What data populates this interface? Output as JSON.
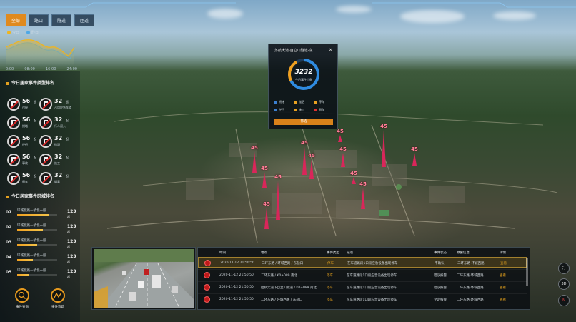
{
  "tabs": [
    {
      "label": "全部",
      "active": true
    },
    {
      "label": "路口",
      "active": false
    },
    {
      "label": "隧道",
      "active": false
    },
    {
      "label": "匝道",
      "active": false
    }
  ],
  "legend": {
    "today": "今日",
    "yesterday": "昨日",
    "today_color": "#f0b51e",
    "yesterday_color": "#4da8e6"
  },
  "trend_axis": [
    "0:00",
    "08:00",
    "16:00",
    "24:00"
  ],
  "event_type_title": "今日居家事件类型排名",
  "event_types": [
    {
      "value": "56",
      "unit": "起",
      "label": "违停"
    },
    {
      "value": "32",
      "unit": "起",
      "label": "占用应急车道"
    },
    {
      "value": "56",
      "unit": "起",
      "label": "拥堵"
    },
    {
      "value": "32",
      "unit": "起",
      "label": "行人闯入"
    },
    {
      "value": "56",
      "unit": "起",
      "label": "逆行"
    },
    {
      "value": "32",
      "unit": "起",
      "label": "抛洒"
    },
    {
      "value": "56",
      "unit": "起",
      "label": "事故"
    },
    {
      "value": "32",
      "unit": "起",
      "label": "施工"
    },
    {
      "value": "56",
      "unit": "起",
      "label": "倒车"
    },
    {
      "value": "32",
      "unit": "起",
      "label": "烟雾"
    }
  ],
  "region_title": "今日居家事件区域排名",
  "regions": [
    {
      "no": "07",
      "name": "环城北路—桥北一段",
      "value": "123",
      "unit": "起",
      "progress": 0.8
    },
    {
      "no": "02",
      "name": "环城北路—桥北一段",
      "value": "123",
      "unit": "起",
      "progress": 0.65
    },
    {
      "no": "03",
      "name": "环城北路—桥北一段",
      "value": "123",
      "unit": "起",
      "progress": 0.5
    },
    {
      "no": "04",
      "name": "环城北路—桥北一段",
      "value": "123",
      "unit": "起",
      "progress": 0.4
    },
    {
      "no": "05",
      "name": "环城北路—桥北一段",
      "value": "123",
      "unit": "起",
      "progress": 0.3
    }
  ],
  "bottom_buttons": {
    "query": "事件查询",
    "trace": "事件追踪"
  },
  "popup": {
    "title": "苏航大道-自立山隧道-东",
    "count": "3232",
    "count_label": "今日事件个数",
    "options": [
      "拥堵",
      "抛洒",
      "停车",
      "逆行",
      "施工",
      "倒车"
    ],
    "confirm": "筛选"
  },
  "markers": [
    {
      "value": "45"
    },
    {
      "value": "45"
    },
    {
      "value": "45"
    },
    {
      "value": "45"
    },
    {
      "value": "45"
    },
    {
      "value": "45"
    },
    {
      "value": "45"
    },
    {
      "value": "45"
    },
    {
      "value": "45"
    },
    {
      "value": "45"
    },
    {
      "value": "45"
    },
    {
      "value": "45"
    }
  ],
  "table": {
    "headers": [
      "时间",
      "地点",
      "事件类型",
      "描述",
      "事件状态",
      "预警信息",
      "详情"
    ],
    "rows": [
      {
        "time": "2020-11-12 21:50:50",
        "place": "二环东路 / 环城西路 / 东盐口",
        "type": "停车",
        "desc": "在车道路段1口段应急设备出现停车",
        "state": "不确认",
        "warn": "二环东路-环城西路",
        "detail": "查看",
        "highlight": true
      },
      {
        "time": "2020-11-12 21:50:50",
        "place": "二环东路 / K0+089 南北",
        "type": "停车",
        "desc": "在车道路段1口段应急设备出现停车",
        "state": "错误报警",
        "warn": "二环东路-环城西路",
        "detail": "查看",
        "highlight": false
      },
      {
        "time": "2020-11-12 21:50:50",
        "place": "拉萨大道下自立山隧道 / K0+089 南北",
        "type": "停车",
        "desc": "在车道路段1口段应急设备出现停车",
        "state": "错误报警",
        "warn": "二环东路-环城西路",
        "detail": "查看",
        "highlight": false
      },
      {
        "time": "2020-11-12 21:50:50",
        "place": "二环东路 / 环城西路 / 东盐口",
        "type": "停车",
        "desc": "在车道路段1口段应急设备出现停车",
        "state": "至定报警",
        "warn": "二环东路-环城西路",
        "detail": "查看",
        "highlight": false
      }
    ]
  },
  "right_controls": [
    "⛶",
    "3D",
    "N"
  ]
}
